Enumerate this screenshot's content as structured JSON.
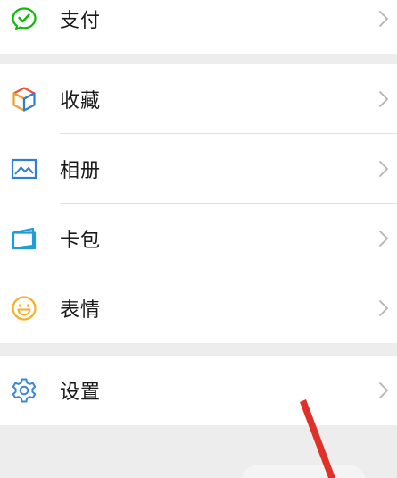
{
  "pay_group": {
    "items": [
      {
        "label": "支付",
        "icon": "wechat-pay-icon",
        "color": "#09bb07"
      }
    ]
  },
  "main_group": {
    "items": [
      {
        "label": "收藏",
        "icon": "favorites-cube-icon",
        "color": "#f0a028"
      },
      {
        "label": "相册",
        "icon": "album-picture-icon",
        "color": "#2e7fd4"
      },
      {
        "label": "卡包",
        "icon": "card-wallet-icon",
        "color": "#1f9ed6"
      },
      {
        "label": "表情",
        "icon": "emoji-smile-icon",
        "color": "#f5b025"
      }
    ]
  },
  "settings_group": {
    "items": [
      {
        "label": "设置",
        "icon": "settings-gear-icon",
        "color": "#3a87d6"
      }
    ]
  },
  "colors": {
    "background": "#ededed",
    "row_background": "#ffffff",
    "text": "#1a1a1a",
    "chevron": "#b2b2b2",
    "annotation_arrow": "#e0302a"
  }
}
